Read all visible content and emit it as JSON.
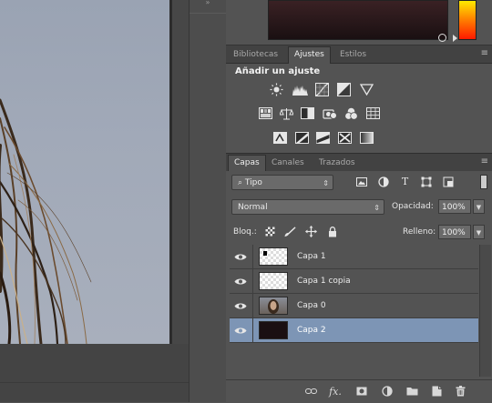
{
  "dock_strip": {
    "grip": "»"
  },
  "adjustments_panel": {
    "tabs": [
      "Bibliotecas",
      "Ajustes",
      "Estilos"
    ],
    "active_tab": "Ajustes",
    "title": "Añadir un ajuste"
  },
  "layers_panel": {
    "tabs": [
      "Capas",
      "Canales",
      "Trazados"
    ],
    "active_tab": "Capas",
    "filter": {
      "value": "Tipo",
      "icon": "search-icon"
    },
    "blend_mode": "Normal",
    "opacity_label": "Opacidad:",
    "opacity_value": "100%",
    "lock_label": "Bloq.:",
    "fill_label": "Relleno:",
    "fill_value": "100%",
    "layers": [
      {
        "name": "Capa 1",
        "thumb": "checker-with-black-dot",
        "visible": true,
        "selected": false
      },
      {
        "name": "Capa 1 copia",
        "thumb": "checker",
        "visible": true,
        "selected": false
      },
      {
        "name": "Capa 0",
        "thumb": "photo-portrait",
        "visible": true,
        "selected": false
      },
      {
        "name": "Capa 2",
        "thumb": "dark-fill",
        "visible": true,
        "selected": true
      }
    ]
  },
  "colors": {
    "panel_bg": "#535353",
    "selected_layer": "#7d95b5",
    "tabbar_bg": "#424242"
  }
}
